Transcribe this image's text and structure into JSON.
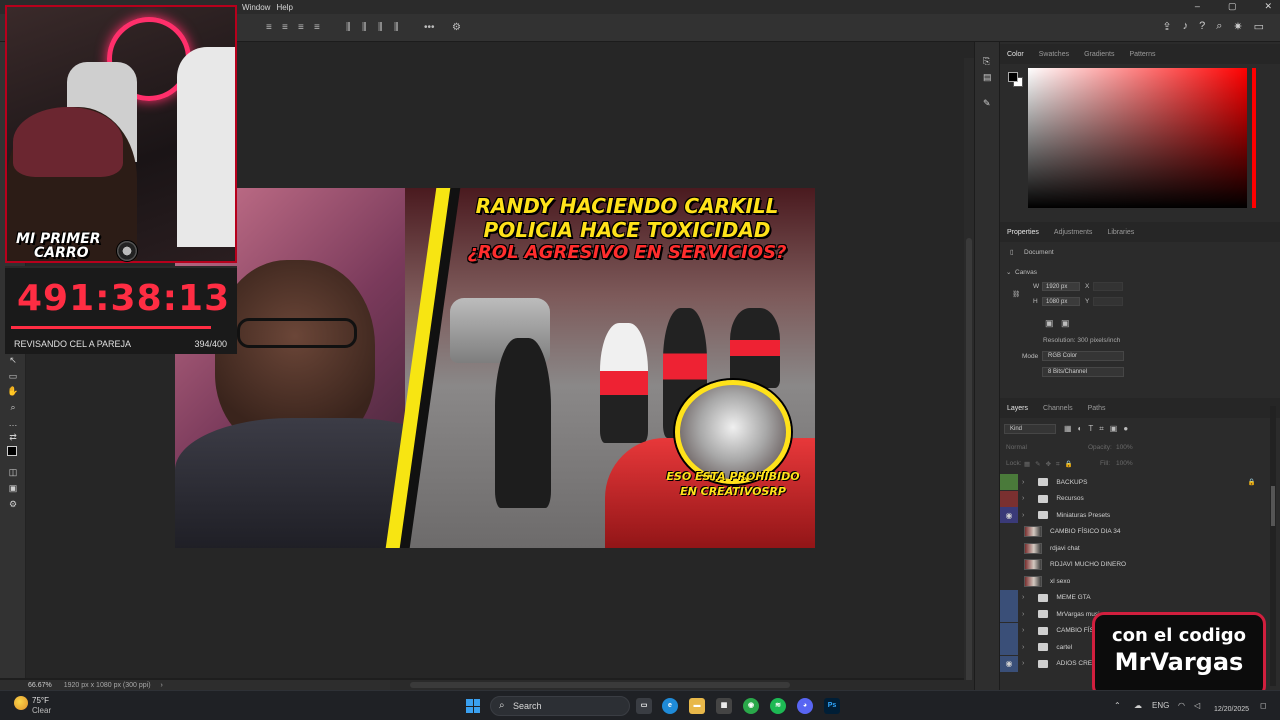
{
  "menubar": {
    "items": [
      "Window",
      "Help"
    ]
  },
  "status": {
    "zoom": "66.67%",
    "doc_info": "1920 px x 1080 px (300 ppi)",
    "arrow": "›"
  },
  "color_panel": {
    "tabs": [
      "Color",
      "Swatches",
      "Gradients",
      "Patterns"
    ],
    "hue_color": "#ff0000",
    "foreground": "#000000",
    "background": "#ffffff"
  },
  "properties_panel": {
    "tabs": [
      "Properties",
      "Adjustments",
      "Libraries"
    ],
    "doc_label": "Document",
    "canvas_label": "Canvas",
    "w_label": "W",
    "w_value": "1920 px",
    "h_label": "H",
    "h_value": "1080 px",
    "x_label": "X",
    "y_label": "Y",
    "resolution": "Resolution: 300 pixels/inch",
    "mode_label": "Mode",
    "mode_value": "RGB Color",
    "bits_value": "8 Bits/Channel"
  },
  "layers_panel": {
    "tabs": [
      "Layers",
      "Channels",
      "Paths"
    ],
    "kind": "Kind",
    "blend": "Normal",
    "opacity_label": "Opacity:",
    "opacity_value": "100%",
    "lock_label": "Lock:",
    "fill_label": "Fill:",
    "fill_value": "100%",
    "layers": [
      {
        "name": "BACKUPS",
        "type": "folder",
        "tag": "#4a7a3a",
        "visible": false,
        "locked": true
      },
      {
        "name": "Recursos",
        "type": "folder",
        "tag": "#7a3030",
        "visible": false
      },
      {
        "name": "Miniaturas Presets",
        "type": "folder",
        "tag": "#3a3a78",
        "visible": true
      },
      {
        "name": "CAMBIO FÍSICO DIA 34",
        "type": "image",
        "visible": false
      },
      {
        "name": "rdjavi chat",
        "type": "image",
        "visible": false
      },
      {
        "name": "RDJAVI MUCHO DINERO",
        "type": "image",
        "visible": false
      },
      {
        "name": "xl sexo",
        "type": "image",
        "visible": false
      },
      {
        "name": "MEME GTA",
        "type": "folder",
        "tag": "#3a4f78",
        "visible": false
      },
      {
        "name": "MrVargas music",
        "type": "folder",
        "tag": "#3a4f78",
        "visible": false
      },
      {
        "name": "CAMBIO FÍSICO",
        "type": "folder",
        "tag": "#3a4f78",
        "visible": false
      },
      {
        "name": "cartel",
        "type": "folder",
        "tag": "#3a4f78",
        "visible": false
      },
      {
        "name": "ADIOS CREATIVO",
        "type": "folder",
        "tag": "#3a4f78",
        "visible": true
      }
    ]
  },
  "thumbnail": {
    "line1": "RANDY HACIENDO CARKILL",
    "line2": "POLICIA HACE TOXICIDAD",
    "line3": "¿ROL AGRESIVO EN SERVICIOS?",
    "badge1": "ESO ESTA PROHIBIDO",
    "badge2": "EN CREATIVOSRP"
  },
  "overlay": {
    "logo_line1": "MI PRIMER",
    "logo_line2": "CARRO",
    "timer": "491:38:13",
    "caption": "REVISANDO CEL A PAREJA",
    "count": "394/400"
  },
  "promo": {
    "line1": "con el codigo",
    "line2": "MrVargas"
  },
  "taskbar": {
    "weather_temp": "75°F",
    "weather_desc": "Clear",
    "search_placeholder": "Search",
    "ps_label": "Ps",
    "lang": "ENG",
    "date": "12/20/2025"
  }
}
